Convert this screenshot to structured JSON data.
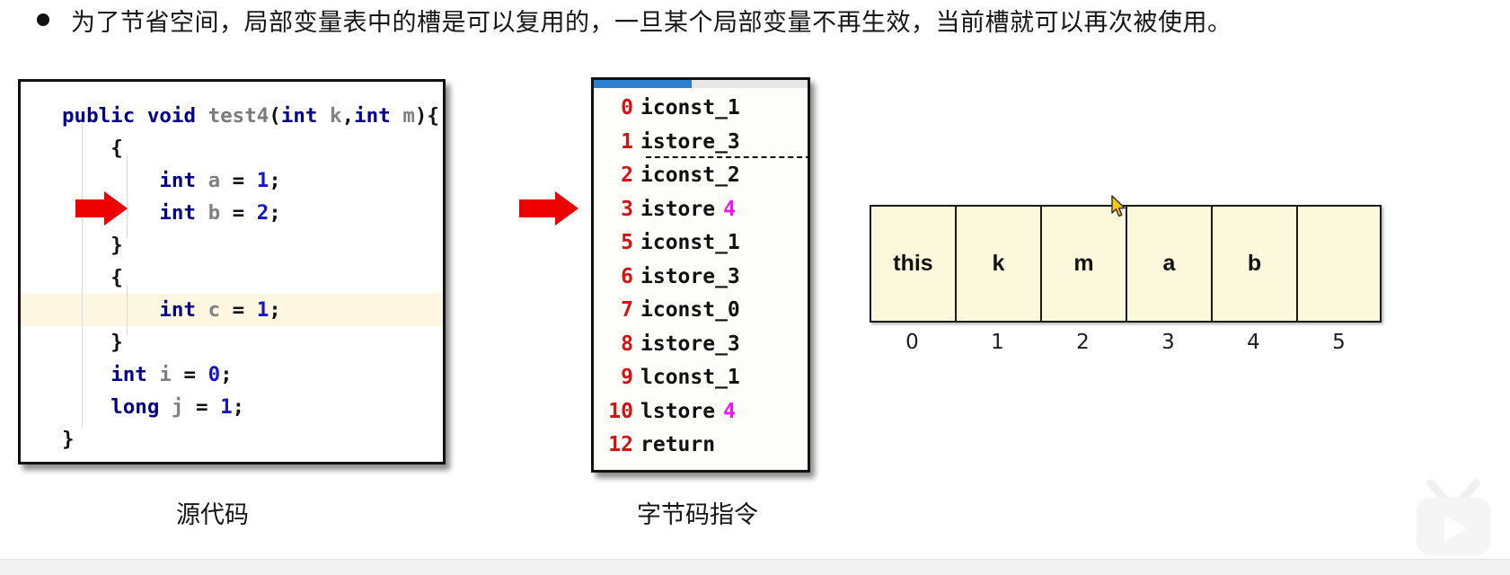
{
  "header": {
    "bullet": "●",
    "text": "为了节省空间，局部变量表中的槽是可以复用的，一旦某个局部变量不再生效，当前槽就可以再次被使用。"
  },
  "source_panel": {
    "caption": "源代码",
    "lines": [
      {
        "tokens": [
          {
            "t": "public",
            "c": "kw"
          },
          {
            "t": " ",
            "c": "pl"
          },
          {
            "t": "void",
            "c": "kw"
          },
          {
            "t": " ",
            "c": "pl"
          },
          {
            "t": "test4",
            "c": "mname"
          },
          {
            "t": "(",
            "c": "pl"
          },
          {
            "t": "int",
            "c": "kw"
          },
          {
            "t": " ",
            "c": "pl"
          },
          {
            "t": "k",
            "c": "id"
          },
          {
            "t": ",",
            "c": "pl"
          },
          {
            "t": "int",
            "c": "kw"
          },
          {
            "t": " ",
            "c": "pl"
          },
          {
            "t": "m",
            "c": "id"
          },
          {
            "t": "){",
            "c": "pl"
          }
        ],
        "indent": 0,
        "highlight": false
      },
      {
        "tokens": [
          {
            "t": "{",
            "c": "pl"
          }
        ],
        "indent": 1,
        "highlight": false
      },
      {
        "tokens": [
          {
            "t": "int",
            "c": "kw"
          },
          {
            "t": " ",
            "c": "pl"
          },
          {
            "t": "a",
            "c": "id"
          },
          {
            "t": " = ",
            "c": "pl"
          },
          {
            "t": "1",
            "c": "num"
          },
          {
            "t": ";",
            "c": "pl"
          }
        ],
        "indent": 2,
        "highlight": false
      },
      {
        "tokens": [
          {
            "t": "int",
            "c": "kw"
          },
          {
            "t": " ",
            "c": "pl"
          },
          {
            "t": "b",
            "c": "id"
          },
          {
            "t": " = ",
            "c": "pl"
          },
          {
            "t": "2",
            "c": "num"
          },
          {
            "t": ";",
            "c": "pl"
          }
        ],
        "indent": 2,
        "highlight": false
      },
      {
        "tokens": [
          {
            "t": "}",
            "c": "pl"
          }
        ],
        "indent": 1,
        "highlight": false
      },
      {
        "tokens": [
          {
            "t": "{",
            "c": "pl"
          }
        ],
        "indent": 1,
        "highlight": false
      },
      {
        "tokens": [
          {
            "t": "int",
            "c": "kw"
          },
          {
            "t": " ",
            "c": "pl"
          },
          {
            "t": "c",
            "c": "id"
          },
          {
            "t": " = ",
            "c": "pl"
          },
          {
            "t": "1",
            "c": "num"
          },
          {
            "t": ";",
            "c": "pl"
          }
        ],
        "indent": 2,
        "highlight": true
      },
      {
        "tokens": [
          {
            "t": "}",
            "c": "pl"
          }
        ],
        "indent": 1,
        "highlight": false
      },
      {
        "tokens": [
          {
            "t": "int",
            "c": "kw"
          },
          {
            "t": " ",
            "c": "pl"
          },
          {
            "t": "i",
            "c": "id"
          },
          {
            "t": " = ",
            "c": "pl"
          },
          {
            "t": "0",
            "c": "num"
          },
          {
            "t": ";",
            "c": "pl"
          }
        ],
        "indent": 1,
        "highlight": false
      },
      {
        "tokens": [
          {
            "t": "long",
            "c": "kw"
          },
          {
            "t": " ",
            "c": "pl"
          },
          {
            "t": "j",
            "c": "id"
          },
          {
            "t": " = ",
            "c": "pl"
          },
          {
            "t": "1",
            "c": "num"
          },
          {
            "t": ";",
            "c": "pl"
          }
        ],
        "indent": 1,
        "highlight": false
      },
      {
        "tokens": [
          {
            "t": "}",
            "c": "pl"
          }
        ],
        "indent": 0,
        "highlight": false
      }
    ]
  },
  "bytecode_panel": {
    "caption": "字节码指令",
    "progress_percent": 46,
    "rows": [
      {
        "index": "0",
        "instruction": "iconst_1",
        "operand": "",
        "underlined": false
      },
      {
        "index": "1",
        "instruction": "istore_3",
        "operand": "",
        "underlined": true
      },
      {
        "index": "2",
        "instruction": "iconst_2",
        "operand": "",
        "underlined": false
      },
      {
        "index": "3",
        "instruction": "istore",
        "operand": "4",
        "underlined": false
      },
      {
        "index": "5",
        "instruction": "iconst_1",
        "operand": "",
        "underlined": false
      },
      {
        "index": "6",
        "instruction": "istore_3",
        "operand": "",
        "underlined": false
      },
      {
        "index": "7",
        "instruction": "iconst_0",
        "operand": "",
        "underlined": false
      },
      {
        "index": "8",
        "instruction": "istore_3",
        "operand": "",
        "underlined": false
      },
      {
        "index": "9",
        "instruction": "lconst_1",
        "operand": "",
        "underlined": false
      },
      {
        "index": "10",
        "instruction": "lstore",
        "operand": "4",
        "underlined": false
      },
      {
        "index": "12",
        "instruction": "return",
        "operand": "",
        "underlined": false
      }
    ]
  },
  "slot_table": {
    "cells": [
      "this",
      "k",
      "m",
      "a",
      "b",
      ""
    ],
    "indices": [
      "0",
      "1",
      "2",
      "3",
      "4",
      "5"
    ]
  },
  "colors": {
    "keyword": "#00008b",
    "identifier": "#808080",
    "number": "#1414cf",
    "bytecode_index": "#d61111",
    "bytecode_operand": "#f016f0",
    "arrow": "#ef0000",
    "slot_fill": "#fcf8dc",
    "highlight_row": "#fdf6e0",
    "progress": "#2f7fd1"
  },
  "icons": {
    "arrow_source": "right-arrow-icon",
    "arrow_bytecode": "right-arrow-icon",
    "cursor": "mouse-pointer-icon",
    "watermark": "bilibili-tv-logo-icon"
  }
}
